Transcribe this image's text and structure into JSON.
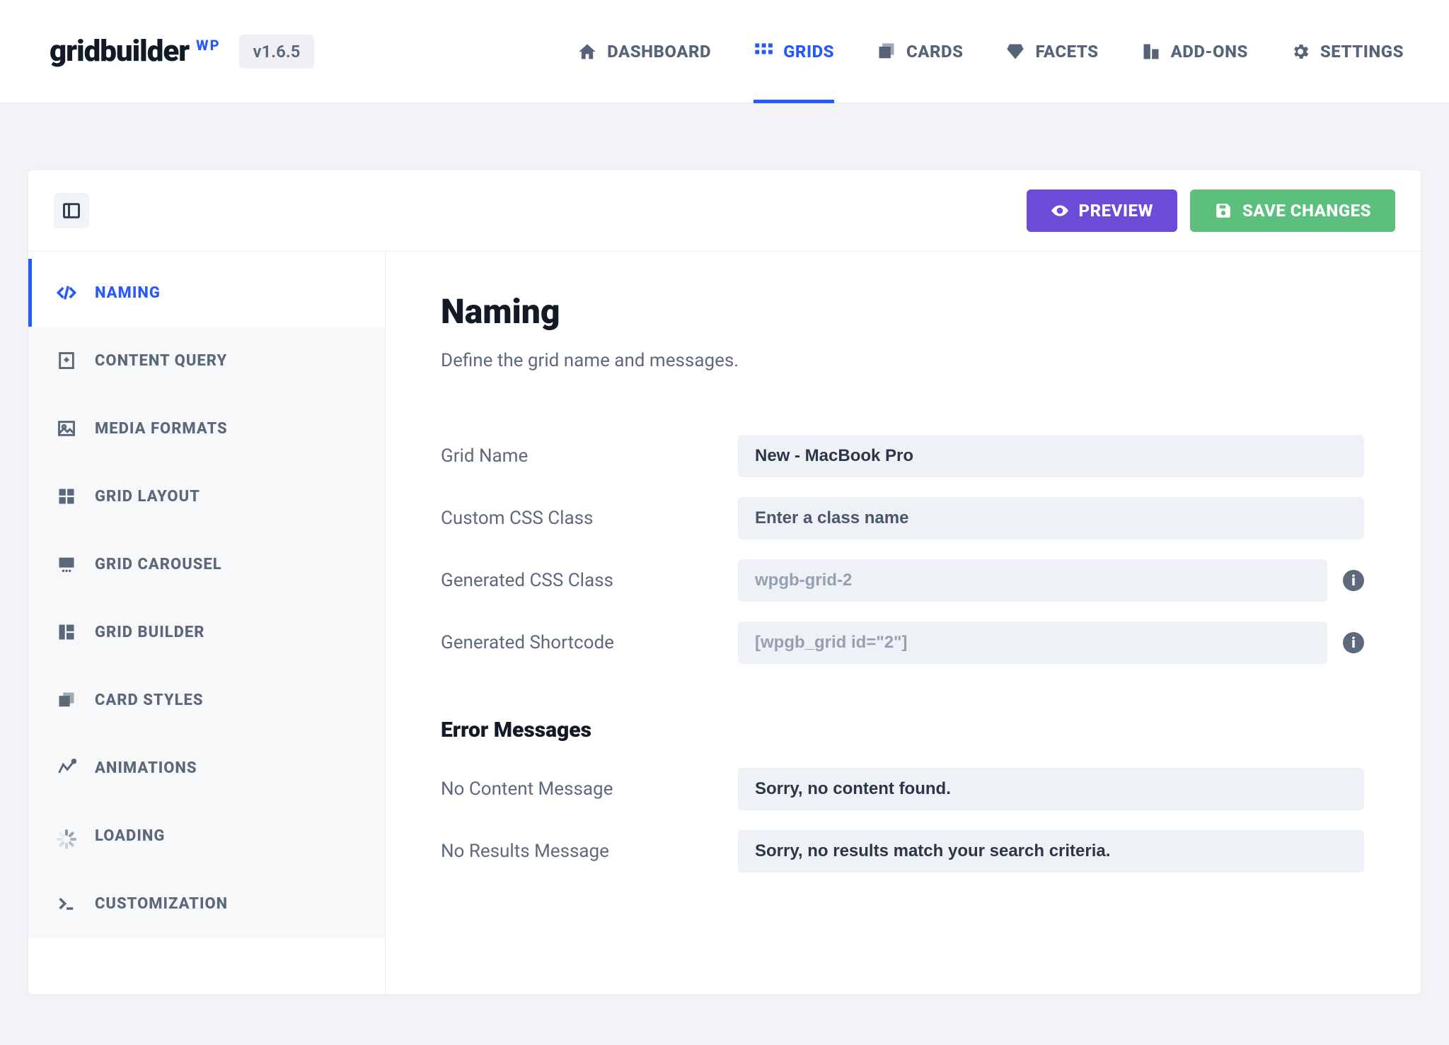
{
  "brand": {
    "name": "gridbuilder",
    "sup": "WP",
    "version": "v1.6.5"
  },
  "nav": {
    "dashboard": "DASHBOARD",
    "grids": "GRIDS",
    "cards": "CARDS",
    "facets": "FACETS",
    "addons": "ADD-ONS",
    "settings": "SETTINGS"
  },
  "actions": {
    "preview": "PREVIEW",
    "save": "SAVE CHANGES"
  },
  "sidebar": {
    "naming": "NAMING",
    "content_query": "CONTENT QUERY",
    "media_formats": "MEDIA FORMATS",
    "grid_layout": "GRID LAYOUT",
    "grid_carousel": "GRID CAROUSEL",
    "grid_builder": "GRID BUILDER",
    "card_styles": "CARD STYLES",
    "animations": "ANIMATIONS",
    "loading": "LOADING",
    "customization": "CUSTOMIZATION"
  },
  "content": {
    "title": "Naming",
    "subtitle": "Define the grid name and messages.",
    "fields": {
      "grid_name": {
        "label": "Grid Name",
        "value": "New - MacBook Pro"
      },
      "custom_css_class": {
        "label": "Custom CSS Class",
        "placeholder": "Enter a class name"
      },
      "gen_css_class": {
        "label": "Generated CSS Class",
        "value": "wpgb-grid-2"
      },
      "gen_shortcode": {
        "label": "Generated Shortcode",
        "value": "[wpgb_grid id=\"2\"]"
      }
    },
    "error_heading": "Error Messages",
    "errors": {
      "no_content": {
        "label": "No Content Message",
        "value": "Sorry, no content found."
      },
      "no_results": {
        "label": "No Results Message",
        "value": "Sorry, no results match your search criteria."
      }
    }
  }
}
